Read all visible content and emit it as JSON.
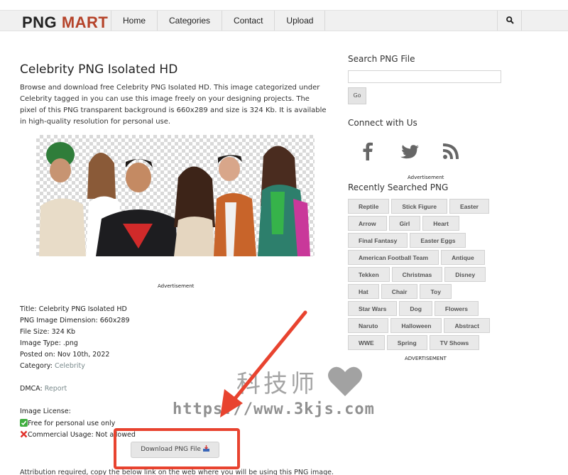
{
  "header": {
    "logo_part1": "PNG",
    "logo_part2": "MART",
    "nav": [
      "Home",
      "Categories",
      "Contact",
      "Upload"
    ],
    "search_icon": "search-icon"
  },
  "main": {
    "title": "Celebrity PNG Isolated HD",
    "description": "Browse and download free Celebrity PNG Isolated HD. This image categorized under Celebrity tagged in you can use this image freely on your designing projects. The pixel of this PNG transparent background is 660x289 and size is 324 Kb. It is available in high-quality resolution for personal use.",
    "advertisement": "Advertisement",
    "meta": {
      "title": "Title: Celebrity PNG Isolated HD",
      "dimension": "PNG Image Dimension: 660x289",
      "file_size": "File Size: 324 Kb",
      "image_type": "Image Type: .png",
      "posted_on": "Posted on: Nov 10th, 2022",
      "category_label": "Category: ",
      "category_value": "Celebrity",
      "dmca_label": "DMCA: ",
      "dmca_value": "Report",
      "license_label": "Image License:",
      "license_personal": "Free for personal use only",
      "license_commercial": "Commercial Usage: Not allowed"
    },
    "download_button": "Download PNG File",
    "attribution": "Attribution required, copy the below link on the web where you will be using this PNG image."
  },
  "sidebar": {
    "search_heading": "Search PNG File",
    "go_button": "Go",
    "connect_heading": "Connect with Us",
    "social_icons": [
      "facebook-icon",
      "twitter-icon",
      "rss-icon"
    ],
    "advertisement": "Advertisement",
    "recent_heading": "Recently Searched PNG",
    "tags": [
      [
        "Reptile",
        "Stick Figure",
        "Easter"
      ],
      [
        "Arrow",
        "Girl",
        "Heart"
      ],
      [
        "Final Fantasy",
        "Easter Eggs"
      ],
      [
        "American Football Team",
        "Antique"
      ],
      [
        "Tekken",
        "Christmas",
        "Disney"
      ],
      [
        "Hat",
        "Chair",
        "Toy"
      ],
      [
        "Star Wars",
        "Dog",
        "Flowers"
      ],
      [
        "Naruto",
        "Halloween",
        "Abstract"
      ],
      [
        "WWE",
        "Spring",
        "TV Shows"
      ]
    ],
    "advertisement_caps": "ADVERTISEMENT"
  },
  "watermark": {
    "chinese": "科技师",
    "url": "https://www.3kjs.com"
  },
  "colors": {
    "logo_accent": "#b5432a",
    "highlight_red": "#e8432f",
    "link_gray": "#7a8a8c"
  }
}
